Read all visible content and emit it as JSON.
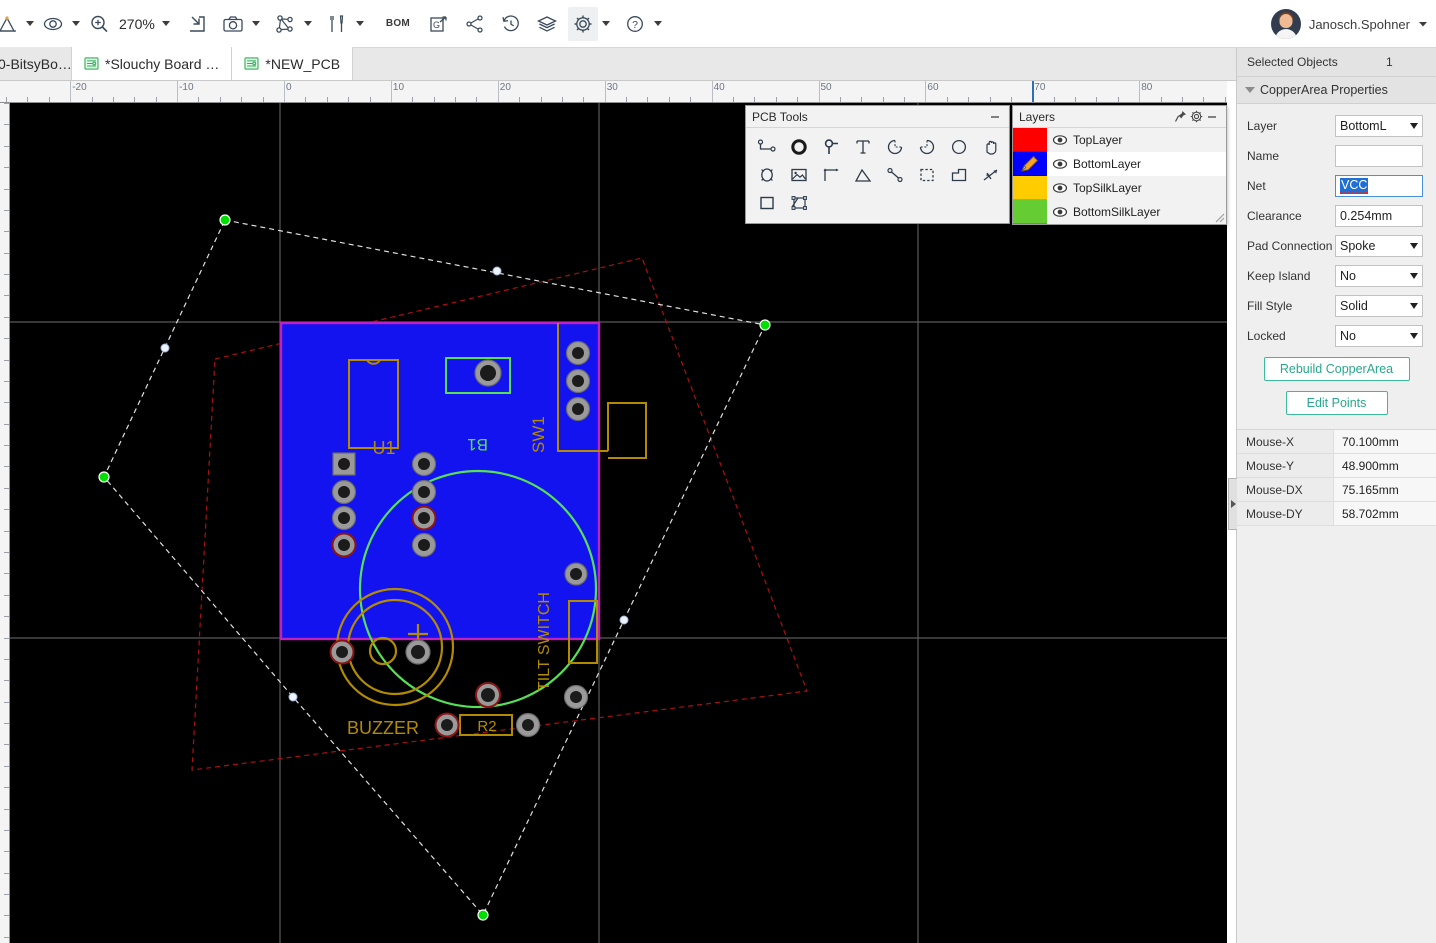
{
  "app": {
    "zoom_level": "270%",
    "user_name": "Janosch.Spohner"
  },
  "toolbar": {
    "items": [
      {
        "name": "route-tool",
        "icon": "route-icon",
        "caret": true
      },
      {
        "name": "visibility",
        "icon": "eye-icon",
        "caret": true
      },
      {
        "name": "zoom",
        "icon": "zoom-in-icon",
        "caret": false
      },
      {
        "name": "zoom-level",
        "icon": "zoom-level-text",
        "caret": true
      },
      {
        "name": "import",
        "icon": "import-icon",
        "caret": false
      },
      {
        "name": "screenshot",
        "icon": "camera-icon",
        "caret": true
      },
      {
        "name": "netlist",
        "icon": "net-icon",
        "caret": true
      },
      {
        "name": "tools",
        "icon": "tools-icon",
        "caret": true
      },
      {
        "name": "bom",
        "icon": "bom-text",
        "caret": false
      },
      {
        "name": "export-gerber",
        "icon": "gerber-icon",
        "caret": false
      },
      {
        "name": "share",
        "icon": "share-icon",
        "caret": false
      },
      {
        "name": "history",
        "icon": "history-icon",
        "caret": false
      },
      {
        "name": "layers",
        "icon": "layers-stack-icon",
        "caret": false
      },
      {
        "name": "settings",
        "icon": "gear-icon",
        "caret": true
      },
      {
        "name": "help",
        "icon": "question-icon",
        "caret": true
      }
    ],
    "bom_label": "BOM"
  },
  "tabs": [
    {
      "label": "0-BitsyBo…",
      "active": false,
      "partial": true
    },
    {
      "label": "*Slouchy Board …",
      "active": true,
      "partial": false
    },
    {
      "label": "*NEW_PCB",
      "active": true,
      "partial": false
    }
  ],
  "ruler": {
    "labels": [
      "-20",
      "-10",
      "0",
      "10",
      "20",
      "30",
      "40",
      "50",
      "60",
      "70",
      "80"
    ],
    "cursor_label": "70",
    "unit": "mm"
  },
  "pcb_tools": {
    "title": "PCB Tools",
    "minimize_label": "—",
    "tools": [
      {
        "name": "track-tool",
        "icon": "track-icon"
      },
      {
        "name": "pad-tool",
        "icon": "pad-icon"
      },
      {
        "name": "via-tool",
        "icon": "via-icon"
      },
      {
        "name": "text-tool",
        "icon": "text-icon"
      },
      {
        "name": "arc-cw-tool",
        "icon": "arc-cw-icon"
      },
      {
        "name": "arc-ccw-tool",
        "icon": "arc-ccw-icon"
      },
      {
        "name": "circle-tool",
        "icon": "circle-icon"
      },
      {
        "name": "drag-tool",
        "icon": "hand-icon"
      },
      {
        "name": "hole-tool",
        "icon": "hole-icon"
      },
      {
        "name": "image-tool",
        "icon": "image-icon"
      },
      {
        "name": "dimension-tool",
        "icon": "dimension-icon"
      },
      {
        "name": "angle-tool",
        "icon": "angle-icon"
      },
      {
        "name": "measure-tool",
        "icon": "measure-icon"
      },
      {
        "name": "select-area-tool",
        "icon": "marquee-icon"
      },
      {
        "name": "copper-area-tool",
        "icon": "copper-area-icon"
      },
      {
        "name": "ratline-tool",
        "icon": "ratline-icon"
      },
      {
        "name": "rect-tool",
        "icon": "rectangle-icon"
      },
      {
        "name": "panelize-tool",
        "icon": "panelize-icon"
      }
    ]
  },
  "layers_panel": {
    "title": "Layers",
    "pin_label": "pin",
    "layers": [
      {
        "name": "TopLayer",
        "color": "#ff0000",
        "visible": true,
        "active": false
      },
      {
        "name": "BottomLayer",
        "color": "#0000ff",
        "visible": true,
        "active": true
      },
      {
        "name": "TopSilkLayer",
        "color": "#ffcc00",
        "visible": true,
        "active": false
      },
      {
        "name": "BottomSilkLayer",
        "color": "#66cc33",
        "visible": true,
        "active": false
      }
    ]
  },
  "right_panel": {
    "selected_objects_label": "Selected Objects",
    "selected_objects_count": "1",
    "properties_title": "CopperArea Properties",
    "properties": [
      {
        "label": "Layer",
        "type": "select",
        "value": "BottomL"
      },
      {
        "label": "Name",
        "type": "input",
        "value": ""
      },
      {
        "label": "Net",
        "type": "input",
        "value": "VCC",
        "selected": true
      },
      {
        "label": "Clearance",
        "type": "input",
        "value": "0.254mm"
      },
      {
        "label": "Pad Connection",
        "type": "select",
        "value": "Spoke"
      },
      {
        "label": "Keep Island",
        "type": "select",
        "value": "No"
      },
      {
        "label": "Fill Style",
        "type": "select",
        "value": "Solid"
      },
      {
        "label": "Locked",
        "type": "select",
        "value": "No"
      }
    ],
    "rebuild_button": "Rebuild CopperArea",
    "edit_points_button": "Edit Points",
    "mouse_info": [
      {
        "key": "Mouse-X",
        "value": "70.100mm"
      },
      {
        "key": "Mouse-Y",
        "value": "48.900mm"
      },
      {
        "key": "Mouse-DX",
        "value": "75.165mm"
      },
      {
        "key": "Mouse-DY",
        "value": "58.702mm"
      }
    ]
  },
  "board": {
    "silkscreen_labels": [
      "U1",
      "B1",
      "SW1",
      "TILT SWITCH",
      "BUZZER",
      "R2"
    ],
    "colors": {
      "bottom_copper": "#1313f0",
      "board_outline": "#c020c0",
      "silk_top": "#b38b00",
      "silk_bottom": "#55e055",
      "pad_ring": "#9a9a9a",
      "pad_hole": "#1b1b1b",
      "copper_area_outline": "#e8e8e8",
      "vertex_handle": "#00e000",
      "midpoint_handle": "#e8f0ff",
      "keepout": "#aa1111",
      "grid_line": "#5a5a5a"
    }
  }
}
